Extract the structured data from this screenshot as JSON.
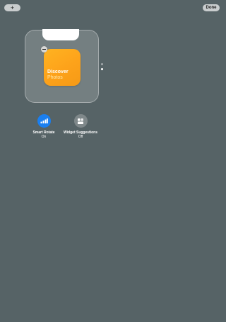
{
  "toolbar": {
    "add_label": "+",
    "done_label": "Done"
  },
  "widget": {
    "title": "Discover",
    "subtitle": "Photos",
    "gradient_colors": [
      "#ffb321",
      "#f69a16"
    ]
  },
  "stack": {
    "page_count": 2,
    "active_page": 2
  },
  "toggles": [
    {
      "label": "Smart Rotate",
      "state": "On",
      "icon": "smart-rotate-icon",
      "color": "#1a7ff0"
    },
    {
      "label": "Widget Suggestions",
      "state": "Off",
      "icon": "widget-suggestions-icon",
      "color": "#7f888a"
    }
  ],
  "colors": {
    "background": "#566366",
    "accent": "#1a7ff0"
  }
}
